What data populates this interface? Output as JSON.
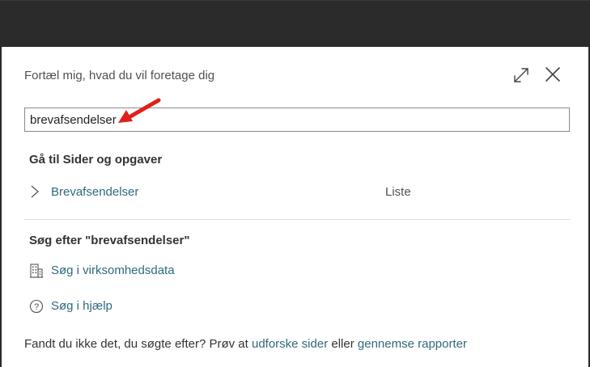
{
  "dialog": {
    "title": "Fortæl mig, hvad du vil foretage dig",
    "expand_icon": "expand-icon",
    "close_icon": "close-icon"
  },
  "search": {
    "value": "brevafsendelser",
    "annotation": "red-arrow-icon",
    "annotation_color": "#e0201a"
  },
  "goto": {
    "heading": "Gå til Sider og opgaver",
    "results": [
      {
        "label": "Brevafsendelser",
        "type": "Liste"
      }
    ]
  },
  "search_section": {
    "heading": "Søg efter \"brevafsendelser\"",
    "actions": [
      {
        "icon": "building-icon",
        "label": "Søg i virksomhedsdata"
      },
      {
        "icon": "help-circle-icon",
        "label": "Søg i hjælp"
      }
    ]
  },
  "footer": {
    "text_before": "Fandt du ikke det, du søgte efter? Prøv at ",
    "link1": "udforske sider",
    "text_middle": " eller ",
    "link2": "gennemse rapporter"
  },
  "colors": {
    "link": "#2e6a7a",
    "background_dark": "#2b2b2b",
    "dialog_background": "#ffffff"
  }
}
